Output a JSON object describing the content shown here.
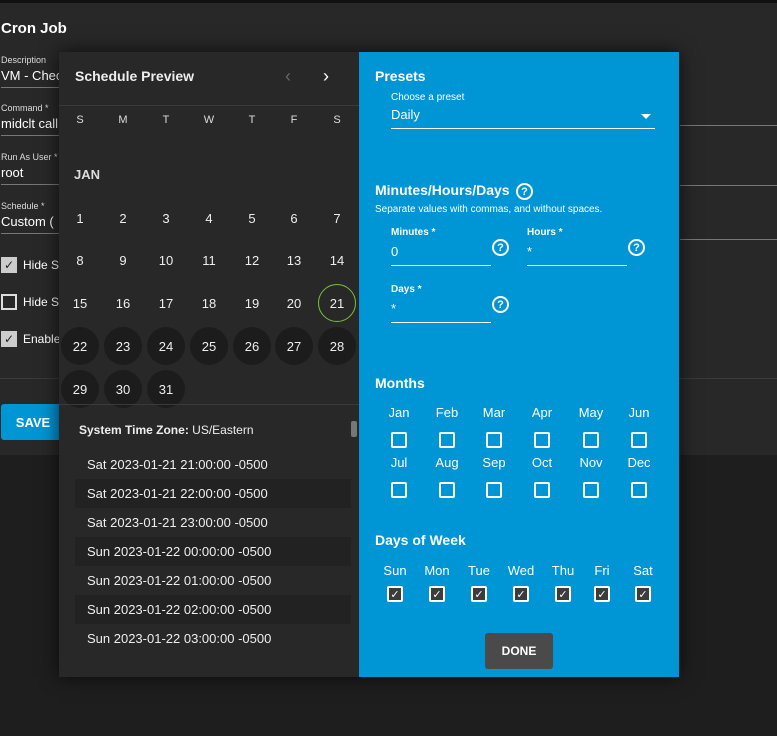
{
  "background_form": {
    "title": "Cron Job",
    "fields": [
      {
        "label": "Description",
        "value": "VM - Check"
      },
      {
        "label": "Command *",
        "value": "midclt call"
      },
      {
        "label": "Run As User *",
        "value": "root"
      },
      {
        "label": "Schedule *",
        "value": "Custom ("
      }
    ],
    "checkboxes": [
      {
        "label": "Hide S",
        "checked": true
      },
      {
        "label": "Hide S",
        "checked": false
      },
      {
        "label": "Enable",
        "checked": true
      }
    ],
    "save_label": "SAVE"
  },
  "preview": {
    "title": "Schedule Preview",
    "weekdays": [
      "S",
      "M",
      "T",
      "W",
      "T",
      "F",
      "S"
    ],
    "month": "JAN",
    "days": [
      "1",
      "2",
      "3",
      "4",
      "5",
      "6",
      "7",
      "8",
      "9",
      "10",
      "11",
      "12",
      "13",
      "14",
      "15",
      "16",
      "17",
      "18",
      "19",
      "20",
      "21",
      "22",
      "23",
      "24",
      "25",
      "26",
      "27",
      "28",
      "29",
      "30",
      "31"
    ],
    "today": "21",
    "timezone_label": "System Time Zone:",
    "timezone": "US/Eastern",
    "runs": [
      "Sat 2023-01-21 21:00:00 -0500",
      "Sat 2023-01-21 22:00:00 -0500",
      "Sat 2023-01-21 23:00:00 -0500",
      "Sun 2023-01-22 00:00:00 -0500",
      "Sun 2023-01-22 01:00:00 -0500",
      "Sun 2023-01-22 02:00:00 -0500",
      "Sun 2023-01-22 03:00:00 -0500"
    ]
  },
  "presets": {
    "heading": "Presets",
    "label": "Choose a preset",
    "value": "Daily"
  },
  "mhd": {
    "heading": "Minutes/Hours/Days",
    "hint": "Separate values with commas, and without spaces.",
    "minutes": {
      "label": "Minutes *",
      "value": "0"
    },
    "hours": {
      "label": "Hours *",
      "value": "*"
    },
    "days": {
      "label": "Days *",
      "value": "*"
    }
  },
  "months": {
    "heading": "Months",
    "items": [
      "Jan",
      "Feb",
      "Mar",
      "Apr",
      "May",
      "Jun",
      "Jul",
      "Aug",
      "Sep",
      "Oct",
      "Nov",
      "Dec"
    ]
  },
  "dow": {
    "heading": "Days of Week",
    "items": [
      "Sun",
      "Mon",
      "Tue",
      "Wed",
      "Thu",
      "Fri",
      "Sat"
    ]
  },
  "done_label": "DONE",
  "icons": {
    "help": "help-circle-icon",
    "prev": "chevron-left-icon",
    "next": "chevron-right-icon",
    "check": "check-icon"
  },
  "colors": {
    "accent": "#0095d5",
    "today_ring": "#7bbf3a"
  }
}
